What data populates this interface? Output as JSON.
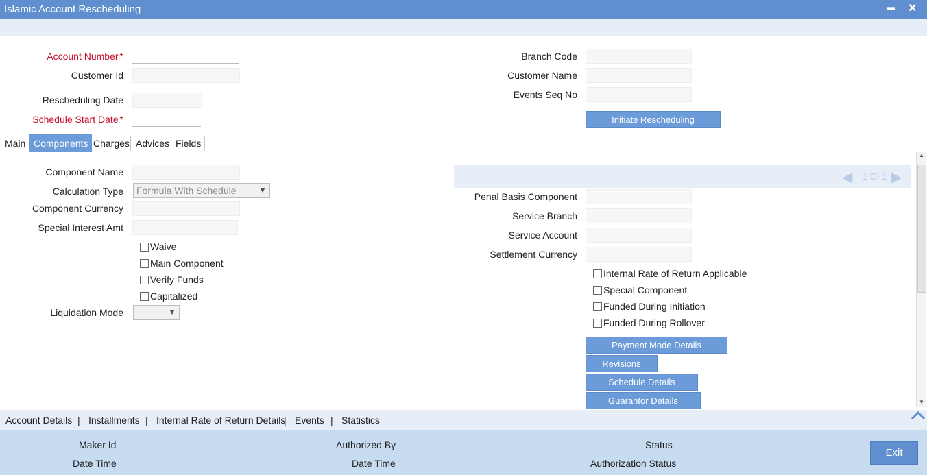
{
  "window": {
    "title": "Islamic Account Rescheduling",
    "minimize": "▬",
    "close": "✕"
  },
  "header": {
    "account_number_label": "Account Number",
    "customer_id_label": "Customer Id",
    "rescheduling_date_label": "Rescheduling Date",
    "schedule_start_date_label": "Schedule Start Date",
    "branch_code_label": "Branch Code",
    "customer_name_label": "Customer Name",
    "events_seq_no_label": "Events Seq No",
    "initiate_button": "Initiate Rescheduling",
    "required_mark": "*"
  },
  "tabs": [
    "Main",
    "Components",
    "Charges",
    "Advices",
    "Fields"
  ],
  "components": {
    "component_name_label": "Component Name",
    "calculation_type_label": "Calculation Type",
    "calculation_type_value": "Formula With Schedule",
    "component_currency_label": "Component Currency",
    "special_interest_amt_label": "Special Interest Amt",
    "checkboxes_left": [
      "Waive",
      "Main Component",
      "Verify Funds",
      "Capitalized"
    ],
    "liquidation_mode_label": "Liquidation Mode",
    "pager_text": "1 Of 1",
    "penal_basis_label": "Penal Basis Component",
    "service_branch_label": "Service Branch",
    "service_account_label": "Service Account",
    "settlement_currency_label": "Settlement Currency",
    "checkboxes_right": [
      "Internal Rate of Return Applicable",
      "Special Component",
      "Funded During Initiation",
      "Funded During Rollover"
    ],
    "buttons": [
      "Payment Mode Details",
      "Revisions",
      "Schedule Details",
      "Guarantor Details"
    ]
  },
  "bottom_nav": [
    "Account Details",
    "Installments",
    "Internal Rate of Return Details",
    "Events",
    "Statistics"
  ],
  "bottom_nav_sep": "|",
  "footer": {
    "maker_id": "Maker Id",
    "date_time_1": "Date Time",
    "authorized_by": "Authorized By",
    "date_time_2": "Date Time",
    "status": "Status",
    "authorization_status": "Authorization Status",
    "exit": "Exit"
  },
  "colors": {
    "accent": "#5f8fcf",
    "button": "#6b9bd8",
    "required": "#c8102e",
    "footer_bg": "#c7dcf0"
  }
}
